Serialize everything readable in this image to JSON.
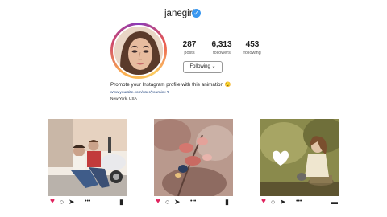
{
  "profile": {
    "username": "janegirl",
    "verified_icon": "verified-badge-icon",
    "stats": {
      "posts": {
        "value": "287",
        "label": "posts"
      },
      "followers": {
        "value": "6,313",
        "label": "followers"
      },
      "following": {
        "value": "453",
        "label": "following"
      }
    },
    "follow_button": "Following",
    "bio": "Promote your Instagram profile with this animation 😉",
    "link": "www.yoursite.com/user/yournick ♥",
    "location": "New York, USA"
  },
  "posts": [
    {
      "icons": [
        "heart-icon",
        "comment-icon",
        "share-icon",
        "more-icon",
        "bookmark-icon"
      ]
    },
    {
      "icons": [
        "heart-icon",
        "comment-icon",
        "share-icon",
        "more-icon",
        "bookmark-icon"
      ]
    },
    {
      "icons": [
        "heart-icon",
        "comment-icon",
        "share-icon",
        "more-icon",
        "save-icon"
      ]
    }
  ],
  "colors": {
    "verified": "#3897f0",
    "like": "#e0245e",
    "link": "#1a3e7a"
  }
}
